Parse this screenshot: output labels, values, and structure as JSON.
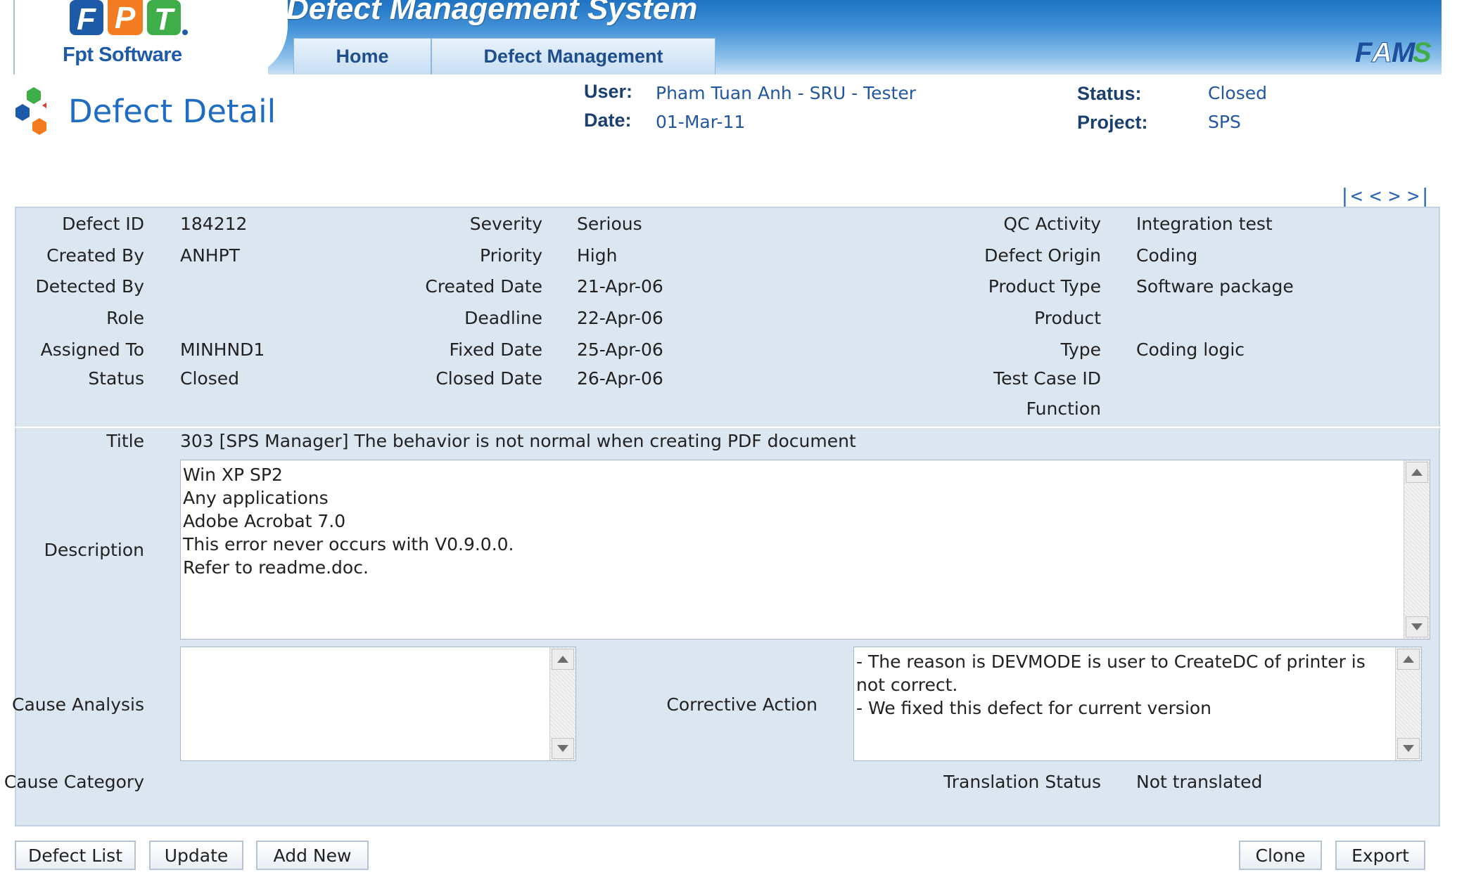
{
  "header": {
    "brand_name": "Fpt Software",
    "logo_text": "FPT",
    "app_title": "Defect Management System",
    "tabs": [
      {
        "label": "Home"
      },
      {
        "label": "Defect Management"
      }
    ],
    "right_logo_text": "FAMS"
  },
  "page": {
    "title": "Defect Detail",
    "info": {
      "user_label": "User:",
      "user_value": "Pham Tuan Anh - SRU - Tester",
      "date_label": "Date:",
      "date_value": "01-Mar-11",
      "status_label": "Status:",
      "status_value": "Closed",
      "project_label": "Project:",
      "project_value": "SPS"
    },
    "pager": {
      "first": "|<",
      "prev": "<",
      "next": ">",
      "last": ">|"
    }
  },
  "details": {
    "col1": [
      {
        "label": "Defect ID",
        "value": "184212"
      },
      {
        "label": "Created By",
        "value": "ANHPT"
      },
      {
        "label": "Detected By",
        "value": ""
      },
      {
        "label": "Role",
        "value": ""
      },
      {
        "label": "Assigned To",
        "value": "MINHND1"
      },
      {
        "label": "Status",
        "value": "Closed"
      }
    ],
    "col2": [
      {
        "label": "Severity",
        "value": "Serious"
      },
      {
        "label": "Priority",
        "value": "High"
      },
      {
        "label": "Created Date",
        "value": "21-Apr-06"
      },
      {
        "label": "Deadline",
        "value": "22-Apr-06"
      },
      {
        "label": "Fixed Date",
        "value": "25-Apr-06"
      },
      {
        "label": "Closed Date",
        "value": "26-Apr-06"
      }
    ],
    "col3": [
      {
        "label": "QC Activity",
        "value": "Integration test"
      },
      {
        "label": "Defect Origin",
        "value": "Coding"
      },
      {
        "label": "Product Type",
        "value": "Software package"
      },
      {
        "label": "Product",
        "value": ""
      },
      {
        "label": "Type",
        "value": "Coding logic"
      },
      {
        "label": "Test Case ID",
        "value": ""
      },
      {
        "label": "Function",
        "value": ""
      }
    ]
  },
  "lower": {
    "title_label": "Title",
    "title_value": "303 [SPS Manager] The behavior is not normal when creating PDF document",
    "description_label": "Description",
    "description_lines": [
      "Win XP SP2",
      "Any applications",
      "Adobe Acrobat 7.0",
      "This error never occurs with V0.9.0.0.",
      "Refer to readme.doc."
    ],
    "cause_analysis_label": "Cause Analysis",
    "cause_analysis_value": "",
    "corrective_action_label": "Corrective Action",
    "corrective_action_lines": [
      "- The reason is DEVMODE is user to CreateDC of printer is not correct.",
      "- We fixed this defect for current version"
    ],
    "cause_category_label": "Cause Category",
    "cause_category_value": "",
    "translation_status_label": "Translation Status",
    "translation_status_value": "Not translated"
  },
  "buttons": {
    "defect_list": "Defect List",
    "update": "Update",
    "add_new": "Add New",
    "clone": "Clone",
    "export": "Export"
  },
  "colors": {
    "banner_blue": "#1e73c2",
    "panel_bg": "#dce6f1",
    "title_blue": "#1f6cc3",
    "fpt_orange": "#f47c20",
    "fpt_blue": "#1d5aa8",
    "fpt_green": "#3fae49"
  }
}
